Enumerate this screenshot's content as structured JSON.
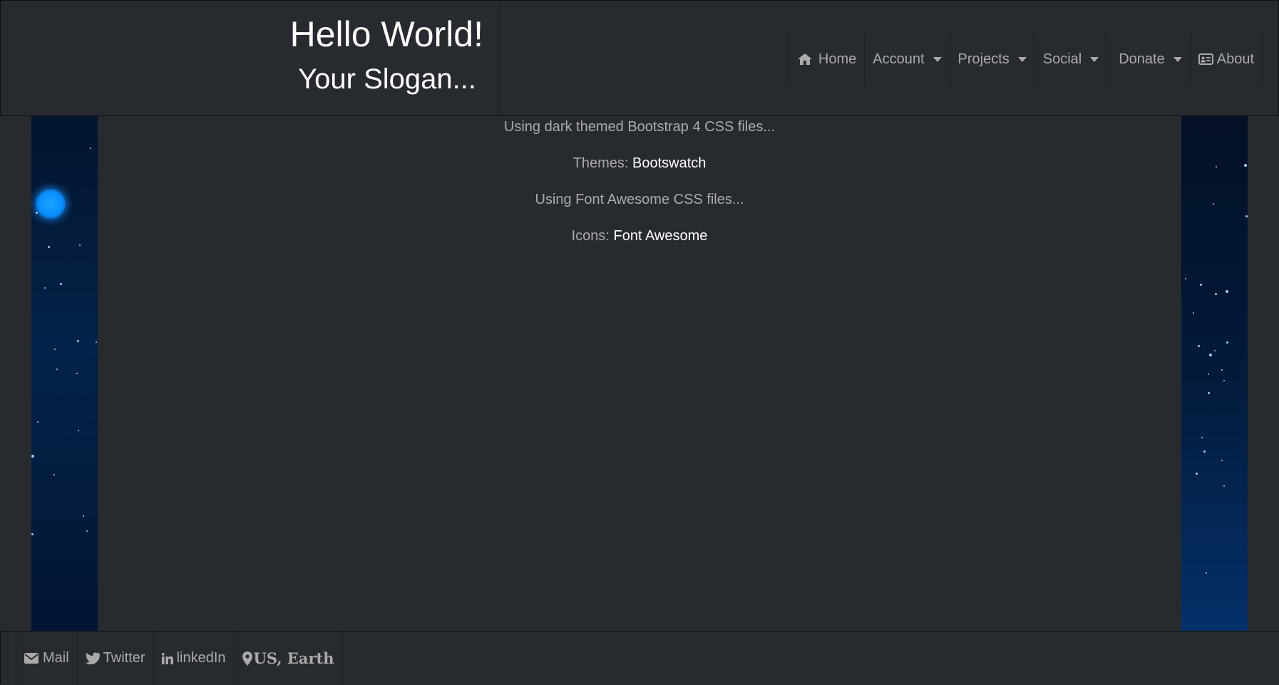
{
  "header": {
    "title": "Hello World!",
    "slogan": "Your Slogan..."
  },
  "nav": {
    "home": "Home",
    "account": "Account",
    "projects": "Projects",
    "social": "Social",
    "donate": "Donate",
    "about": "About"
  },
  "content": {
    "line1": "Using dark themed Bootstrap 4 CSS files...",
    "themes_label": "Themes:",
    "themes_link": "Bootswatch",
    "line3": "Using Font Awesome CSS files...",
    "icons_label": "Icons:",
    "icons_link": "Font Awesome"
  },
  "footer": {
    "mail": "Mail",
    "twitter": "Twitter",
    "linkedin": "linkedIn",
    "location": "US, Earth"
  },
  "colors": {
    "background": "#272b30",
    "text_muted": "#aaaaaa",
    "text_bright": "#ffffff"
  },
  "icons": [
    "home-icon",
    "id-card-icon",
    "envelope-icon",
    "twitter-icon",
    "linkedin-icon",
    "map-marker-icon",
    "caret-down-icon"
  ]
}
